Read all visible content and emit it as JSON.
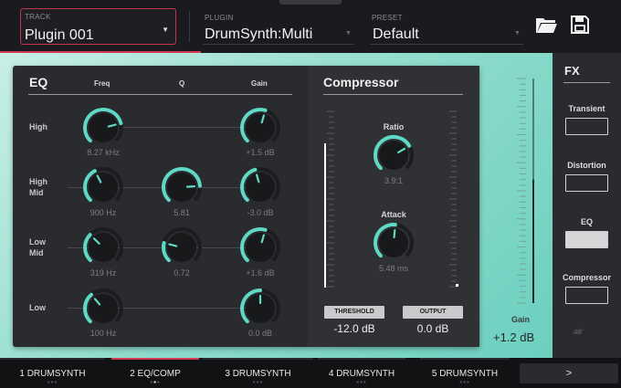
{
  "topbar": {
    "track": {
      "label": "TRACK",
      "value": "Plugin 001"
    },
    "plugin": {
      "label": "PLUGIN",
      "value": "DrumSynth:Multi"
    },
    "preset": {
      "label": "PRESET",
      "value": "Default"
    },
    "icons": [
      "folder-icon",
      "save-icon"
    ]
  },
  "eq": {
    "title": "EQ",
    "columns": [
      "Freq",
      "Q",
      "Gain"
    ],
    "rows": [
      {
        "label_1": "High",
        "label_2": "",
        "freq": "8.27 kHz",
        "q": "",
        "gain": "+1.5 dB"
      },
      {
        "label_1": "High",
        "label_2": "Mid",
        "freq": "900 Hz",
        "q": "5.81",
        "gain": "-3.0 dB"
      },
      {
        "label_1": "Low",
        "label_2": "Mid",
        "freq": "319 Hz",
        "q": "0.72",
        "gain": "+1.6 dB"
      },
      {
        "label_1": "Low",
        "label_2": "",
        "freq": "100 Hz",
        "q": "",
        "gain": "0.0 dB"
      }
    ]
  },
  "compressor": {
    "title": "Compressor",
    "ratio": {
      "label": "Ratio",
      "value": "3.9:1"
    },
    "attack": {
      "label": "Attack",
      "value": "5.48 ms"
    },
    "threshold": {
      "label": "THRESHOLD",
      "value": "-12.0 dB"
    },
    "output": {
      "label": "OUTPUT",
      "value": "0.0 dB"
    }
  },
  "gain": {
    "label": "Gain",
    "value": "+1.2 dB",
    "level": 0.55
  },
  "fx": {
    "title": "FX",
    "slots": [
      {
        "label": "Transient",
        "active": false
      },
      {
        "label": "Distortion",
        "active": false
      },
      {
        "label": "EQ",
        "active": true
      },
      {
        "label": "Compressor",
        "active": false
      }
    ],
    "logo": "air"
  },
  "tabs": [
    {
      "label": "1 DRUMSYNTH",
      "active": false
    },
    {
      "label": "2 EQ/COMP",
      "active": true
    },
    {
      "label": "3 DRUMSYNTH",
      "active": false
    },
    {
      "label": "4 DRUMSYNTH",
      "active": false
    },
    {
      "label": "5 DRUMSYNTH",
      "active": false
    }
  ],
  "next_label": ">",
  "colors": {
    "accent": "#d23a58",
    "knob_arc": "#5fd9c6",
    "teal_bg": "#8fdccd"
  }
}
